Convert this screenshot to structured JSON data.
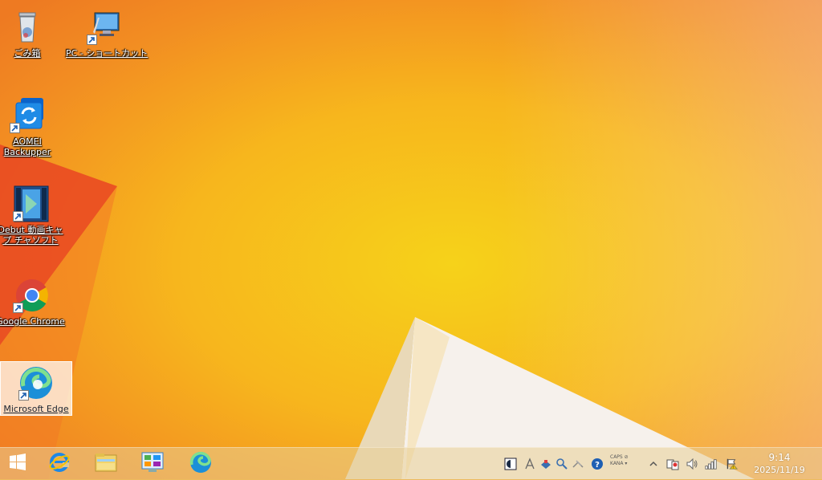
{
  "desktop": {
    "icons": [
      {
        "label": "ごみ箱",
        "icon": "recycle-bin-icon"
      },
      {
        "label": "PC - ショートカット",
        "icon": "pc-shortcut-icon"
      },
      {
        "label": "AOMEI Backupper",
        "icon": "aomei-backupper-icon"
      },
      {
        "label": "Debut 動画キャプ チャソフト",
        "icon": "debut-video-capture-icon"
      },
      {
        "label": "Google Chrome",
        "icon": "chrome-icon"
      },
      {
        "label": "Microsoft Edge",
        "icon": "edge-icon"
      }
    ]
  },
  "taskbar": {
    "pinned": [
      {
        "icon": "start-windows-icon"
      },
      {
        "icon": "internet-explorer-icon"
      },
      {
        "icon": "file-explorer-icon"
      },
      {
        "icon": "control-panel-icon"
      },
      {
        "icon": "edge-icon"
      }
    ],
    "tray": {
      "ime_top": "CAPS ⊘",
      "ime_bottom": "KANA ▾",
      "icons": [
        "ime-mode-icon",
        "language-bar-a-icon",
        "tools-icon",
        "dictionary-search-icon",
        "ime-pad-icon",
        "help-icon",
        "show-hidden-icons-chevron",
        "network-adapter-icon",
        "speaker-icon",
        "wifi-signal-icon",
        "action-center-flag-icon"
      ]
    },
    "clock": {
      "time": "9:14",
      "date": "2025/11/19"
    }
  }
}
